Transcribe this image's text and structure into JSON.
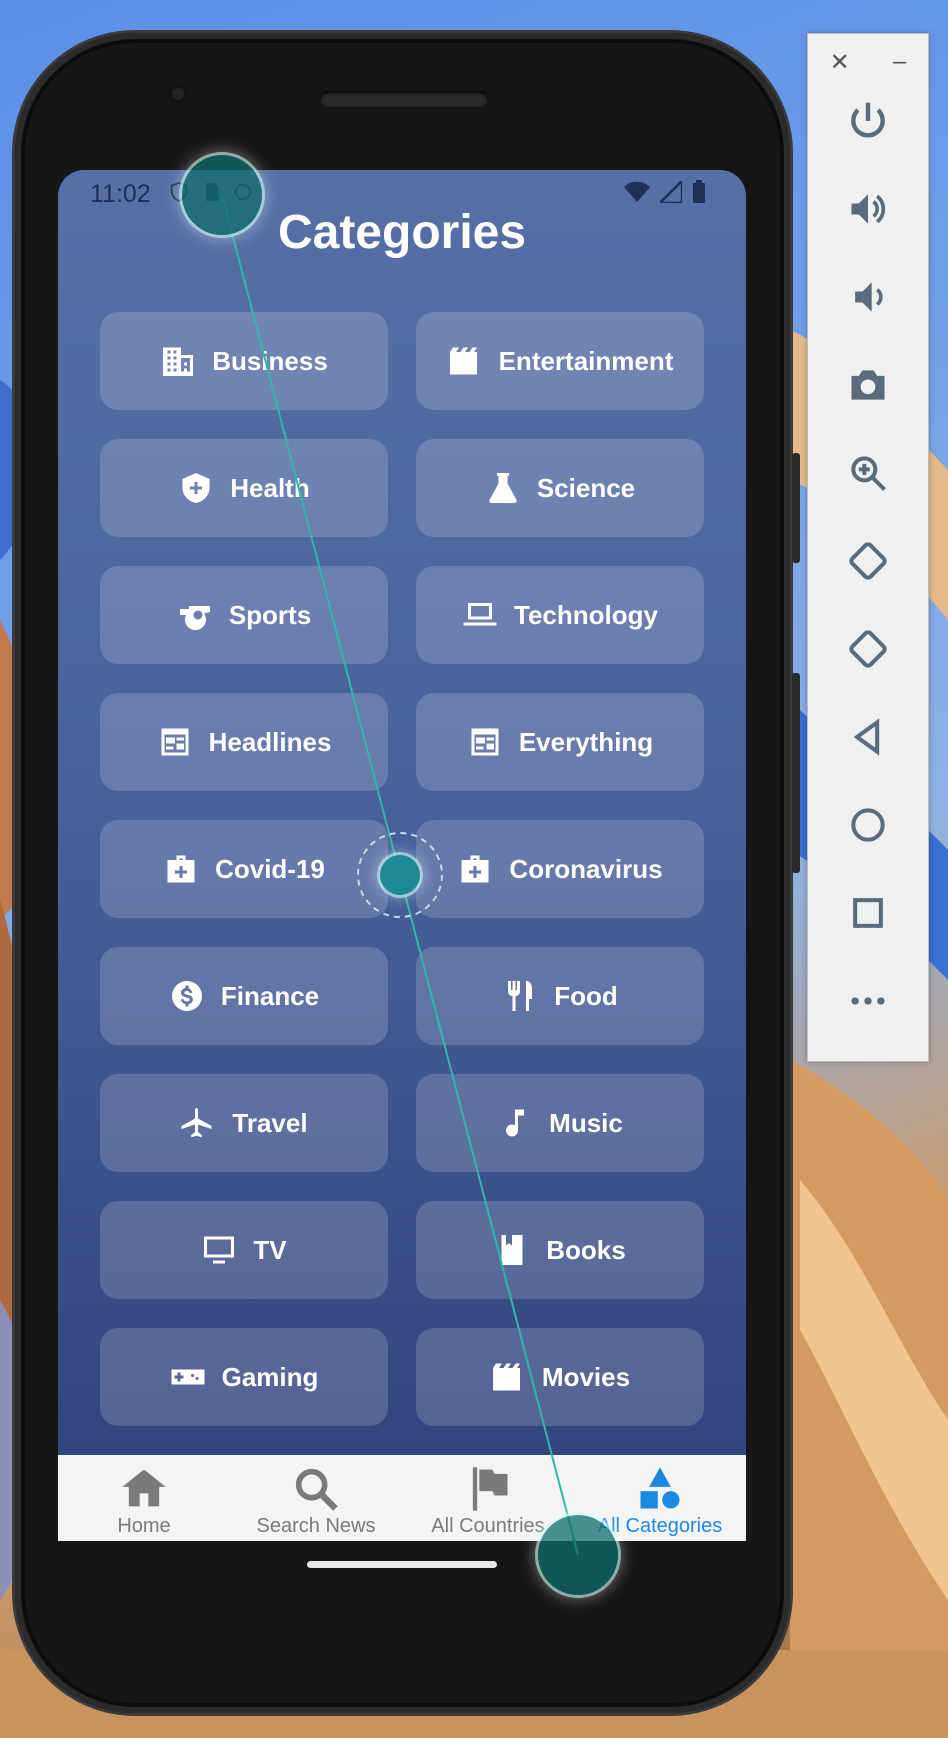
{
  "status": {
    "time": "11:02"
  },
  "screen_title": "Categories",
  "categories": [
    {
      "label": "Business",
      "icon": "building-icon"
    },
    {
      "label": "Entertainment",
      "icon": "clapperboard-icon"
    },
    {
      "label": "Health",
      "icon": "shield-plus-icon"
    },
    {
      "label": "Science",
      "icon": "flask-icon"
    },
    {
      "label": "Sports",
      "icon": "whistle-icon"
    },
    {
      "label": "Technology",
      "icon": "laptop-icon"
    },
    {
      "label": "Headlines",
      "icon": "newspaper-icon"
    },
    {
      "label": "Everything",
      "icon": "newspaper-icon"
    },
    {
      "label": "Covid-19",
      "icon": "medkit-icon"
    },
    {
      "label": "Coronavirus",
      "icon": "medkit-icon"
    },
    {
      "label": "Finance",
      "icon": "dollar-icon"
    },
    {
      "label": "Food",
      "icon": "utensils-icon"
    },
    {
      "label": "Travel",
      "icon": "airplane-icon"
    },
    {
      "label": "Music",
      "icon": "music-note-icon"
    },
    {
      "label": "TV",
      "icon": "tv-icon"
    },
    {
      "label": "Books",
      "icon": "book-icon"
    },
    {
      "label": "Gaming",
      "icon": "gamepad-icon"
    },
    {
      "label": "Movies",
      "icon": "clapperboard-icon"
    }
  ],
  "nav": [
    {
      "label": "Home",
      "icon": "home-icon",
      "active": false
    },
    {
      "label": "Search News",
      "icon": "search-icon",
      "active": false
    },
    {
      "label": "All Countries",
      "icon": "flag-icon",
      "active": false
    },
    {
      "label": "All Categories",
      "icon": "shapes-icon",
      "active": true
    }
  ],
  "emulator_controls": [
    "close-icon",
    "minimize-icon",
    "power-icon",
    "volume-up-icon",
    "volume-down-icon",
    "camera-icon",
    "zoom-icon",
    "rotate-left-icon",
    "rotate-right-icon",
    "back-icon",
    "home-circle-icon",
    "overview-icon",
    "more-icon"
  ],
  "colors": {
    "accent": "#1e88e5",
    "nav_inactive": "#7a7a7a",
    "screen_top": "#5670a6",
    "screen_bottom": "#2e417a"
  }
}
